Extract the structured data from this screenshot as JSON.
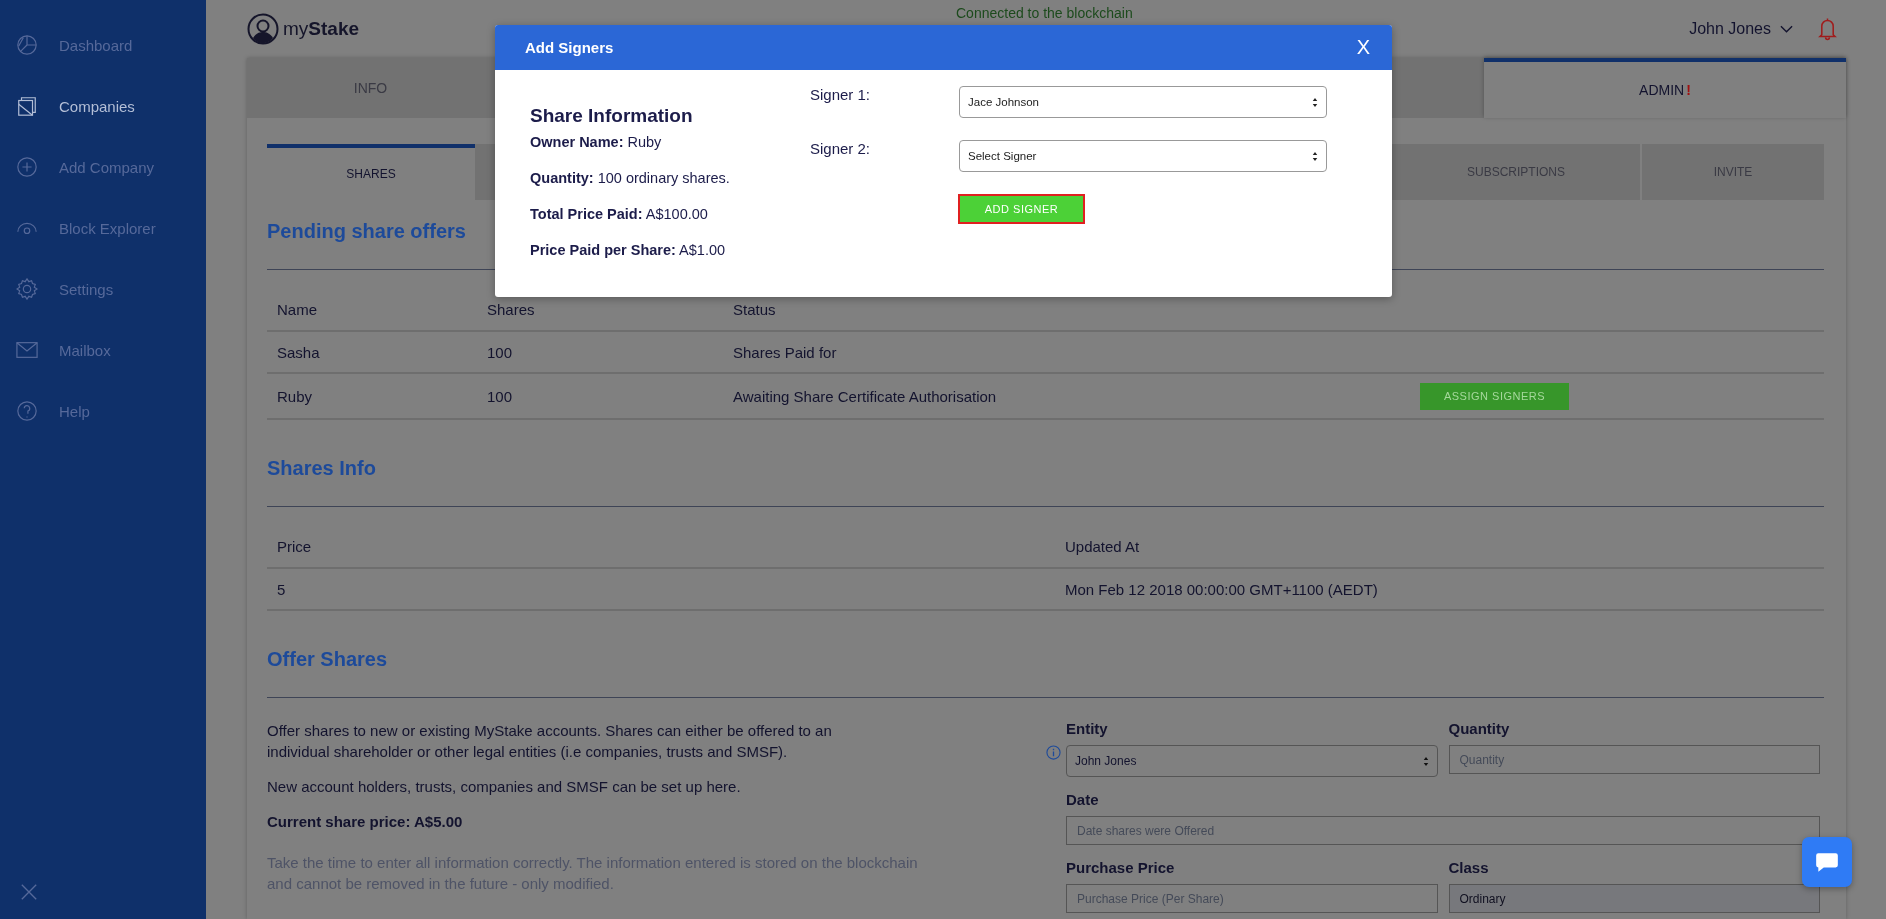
{
  "sidebar": {
    "items": [
      {
        "label": "Dashboard",
        "selected": false
      },
      {
        "label": "Companies",
        "selected": true
      },
      {
        "label": "Add Company",
        "selected": false
      },
      {
        "label": "Block Explorer",
        "selected": false
      },
      {
        "label": "Settings",
        "selected": false
      },
      {
        "label": "Mailbox",
        "selected": false
      },
      {
        "label": "Help",
        "selected": false
      }
    ]
  },
  "header": {
    "logo": "my**Stake**",
    "status": "Connected to the blockchain",
    "user": "John Jones"
  },
  "tabs": [
    {
      "label": "INFO",
      "selected": false
    },
    {
      "label": "ADMIN",
      "badge": "!",
      "selected": true
    }
  ],
  "subtabs": [
    {
      "label": "SHARES",
      "selected": true
    },
    {
      "label": "SUBSCRIPTIONS",
      "selected": false
    },
    {
      "label": "INVITE",
      "selected": false
    }
  ],
  "pending": {
    "title": "Pending share offers",
    "columns": [
      "Name",
      "Shares",
      "Status"
    ],
    "rows": [
      {
        "cells": [
          "Sasha",
          "100",
          "Shares Paid for"
        ]
      },
      {
        "cells": [
          "Ruby",
          "100",
          "Awaiting Share Certificate Authorisation"
        ],
        "action": "ASSIGN SIGNERS"
      }
    ]
  },
  "shares_info": {
    "title": "Shares Info",
    "columns": [
      "Price",
      "Updated At"
    ],
    "rows": [
      {
        "cells": [
          "5",
          "Mon Feb 12 2018 00:00:00 GMT+1100 (AEDT)"
        ]
      }
    ]
  },
  "offer": {
    "title": "Offer Shares",
    "paragraphs": [
      {
        "kind": "normal",
        "text": "Offer shares to new or existing MyStake accounts. Shares can either be offered to an individual shareholder or other legal entities (i.e companies, trusts and SMSF)."
      },
      {
        "kind": "normal",
        "text": "New account holders, trusts, companies and SMSF can be set up here."
      },
      {
        "kind": "bold",
        "text": "Current share price: A$5.00"
      },
      {
        "kind": "note",
        "text": "Take the time to enter all information correctly. The information entered is stored on the blockchain and cannot be removed in the future - only modified."
      }
    ],
    "form": [
      [
        {
          "label": "Entity",
          "kind": "select",
          "value": "John Jones",
          "info": true
        },
        {
          "label": "Quantity",
          "kind": "input",
          "placeholder": "Quantity"
        }
      ],
      [
        {
          "label": "Date",
          "kind": "input",
          "placeholder": "Date shares were Offered"
        }
      ],
      [
        {
          "label": "Purchase Price",
          "kind": "input",
          "placeholder": "Purchase Price (Per Share)"
        },
        {
          "label": "Class",
          "kind": "readonly",
          "value": "Ordinary"
        }
      ]
    ]
  },
  "modal": {
    "title": "Add Signers",
    "close": "X",
    "info_title": "Share Information",
    "info": [
      {
        "label": "Owner Name:",
        "value": "Ruby"
      },
      {
        "label": "Quantity:",
        "value": "100 ordinary shares."
      },
      {
        "label": "Total Price Paid:",
        "value": "A$100.00"
      },
      {
        "label": "Price Paid per Share:",
        "value": "A$1.00"
      }
    ],
    "signers": [
      {
        "label": "Signer 1:",
        "value": "Jace Johnson"
      },
      {
        "label": "Signer 2:",
        "value": "Select Signer"
      }
    ],
    "button": {
      "label": "ADD SIGNER",
      "focused": true
    }
  }
}
